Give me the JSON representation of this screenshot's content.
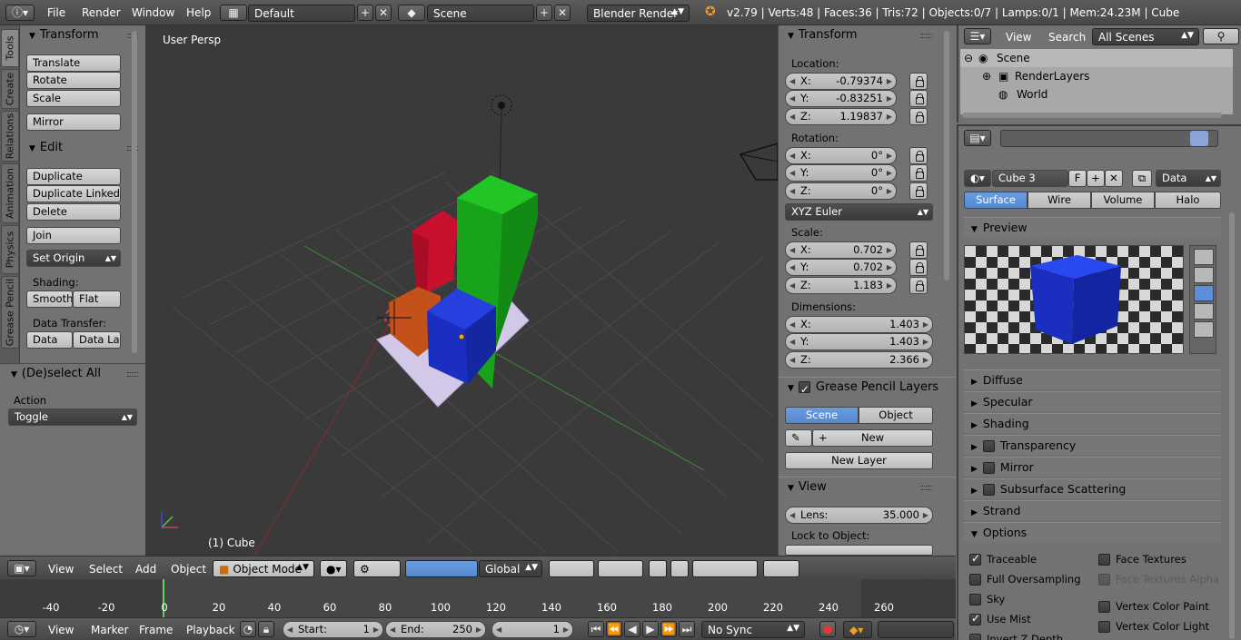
{
  "topbar": {
    "menus": [
      "File",
      "Render",
      "Window",
      "Help"
    ],
    "screen_layout": "Default",
    "scene": "Scene",
    "render_engine": "Blender Render",
    "stats": "v2.79 | Verts:48 | Faces:36 | Tris:72 | Objects:0/7 | Lamps:0/1 | Mem:24.23M | Cube"
  },
  "tool_tabs": [
    "Tools",
    "Create",
    "Relations",
    "Animation",
    "Physics",
    "Grease Pencil"
  ],
  "toolshelf": {
    "transform_title": "Transform",
    "translate": "Translate",
    "rotate": "Rotate",
    "scale": "Scale",
    "mirror": "Mirror",
    "edit_title": "Edit",
    "duplicate": "Duplicate",
    "duplicate_linked": "Duplicate Linked",
    "delete": "Delete",
    "join": "Join",
    "set_origin": "Set Origin",
    "shading_label": "Shading:",
    "smooth": "Smooth",
    "flat": "Flat",
    "data_transfer_label": "Data Transfer:",
    "data": "Data",
    "data_layers": "Data La"
  },
  "operator": {
    "title": "(De)select All",
    "action_label": "Action",
    "action_value": "Toggle"
  },
  "viewport": {
    "label": "User Persp",
    "object_label": "(1) Cube"
  },
  "npanel": {
    "transform_title": "Transform",
    "location_label": "Location:",
    "location": [
      {
        "axis": "X:",
        "value": "-0.79374"
      },
      {
        "axis": "Y:",
        "value": "-0.83251"
      },
      {
        "axis": "Z:",
        "value": "1.19837"
      }
    ],
    "rotation_label": "Rotation:",
    "rotation": [
      {
        "axis": "X:",
        "value": "0°"
      },
      {
        "axis": "Y:",
        "value": "0°"
      },
      {
        "axis": "Z:",
        "value": "0°"
      }
    ],
    "rotation_mode": "XYZ Euler",
    "scale_label": "Scale:",
    "scale": [
      {
        "axis": "X:",
        "value": "0.702"
      },
      {
        "axis": "Y:",
        "value": "0.702"
      },
      {
        "axis": "Z:",
        "value": "1.183"
      }
    ],
    "dimensions_label": "Dimensions:",
    "dimensions": [
      {
        "axis": "X:",
        "value": "1.403"
      },
      {
        "axis": "Y:",
        "value": "1.403"
      },
      {
        "axis": "Z:",
        "value": "2.366"
      }
    ],
    "grease_title": "Grease Pencil Layers",
    "gp_scene": "Scene",
    "gp_object": "Object",
    "gp_new": "New",
    "gp_new_layer": "New Layer",
    "view_title": "View",
    "lens_label": "Lens:",
    "lens_value": "35.000",
    "lock_label": "Lock to Object:"
  },
  "outliner": {
    "view": "View",
    "search": "Search",
    "filter": "All Scenes",
    "items": [
      "Scene",
      "RenderLayers",
      "World"
    ]
  },
  "properties": {
    "material_name": "Cube 3",
    "fake_user": "F",
    "link": "Data",
    "tabs": [
      "Surface",
      "Wire",
      "Volume",
      "Halo"
    ],
    "sections": [
      "Preview",
      "Diffuse",
      "Specular",
      "Shading",
      "Transparency",
      "Mirror",
      "Subsurface Scattering",
      "Strand",
      "Options"
    ],
    "options": {
      "traceable": "Traceable",
      "full_oversampling": "Full Oversampling",
      "sky": "Sky",
      "use_mist": "Use Mist",
      "invert_z": "Invert Z Depth",
      "face_textures": "Face Textures",
      "face_textures_alpha": "Face Textures Alpha",
      "vertex_color_paint": "Vertex Color Paint",
      "vertex_color_light": "Vertex Color Light"
    }
  },
  "vp_header": {
    "menus": [
      "View",
      "Select",
      "Add",
      "Object"
    ],
    "mode": "Object Mode",
    "orientation": "Global"
  },
  "timeline": {
    "ticks": [
      "-40",
      "-20",
      "0",
      "20",
      "40",
      "60",
      "80",
      "100",
      "120",
      "140",
      "160",
      "180",
      "200",
      "220",
      "240",
      "260"
    ],
    "menus": [
      "View",
      "Marker",
      "Frame",
      "Playback"
    ],
    "start_label": "Start:",
    "start_value": "1",
    "end_label": "End:",
    "end_value": "250",
    "current_frame": "1",
    "sync": "No Sync"
  },
  "colors": {
    "accent": "#5e8fd6",
    "viewport_bg": "#3a3a3a",
    "bar_red": "#c8102e",
    "bar_green": "#17a31a",
    "bar_blue": "#1a2fc0",
    "bar_orange": "#c4501a"
  }
}
